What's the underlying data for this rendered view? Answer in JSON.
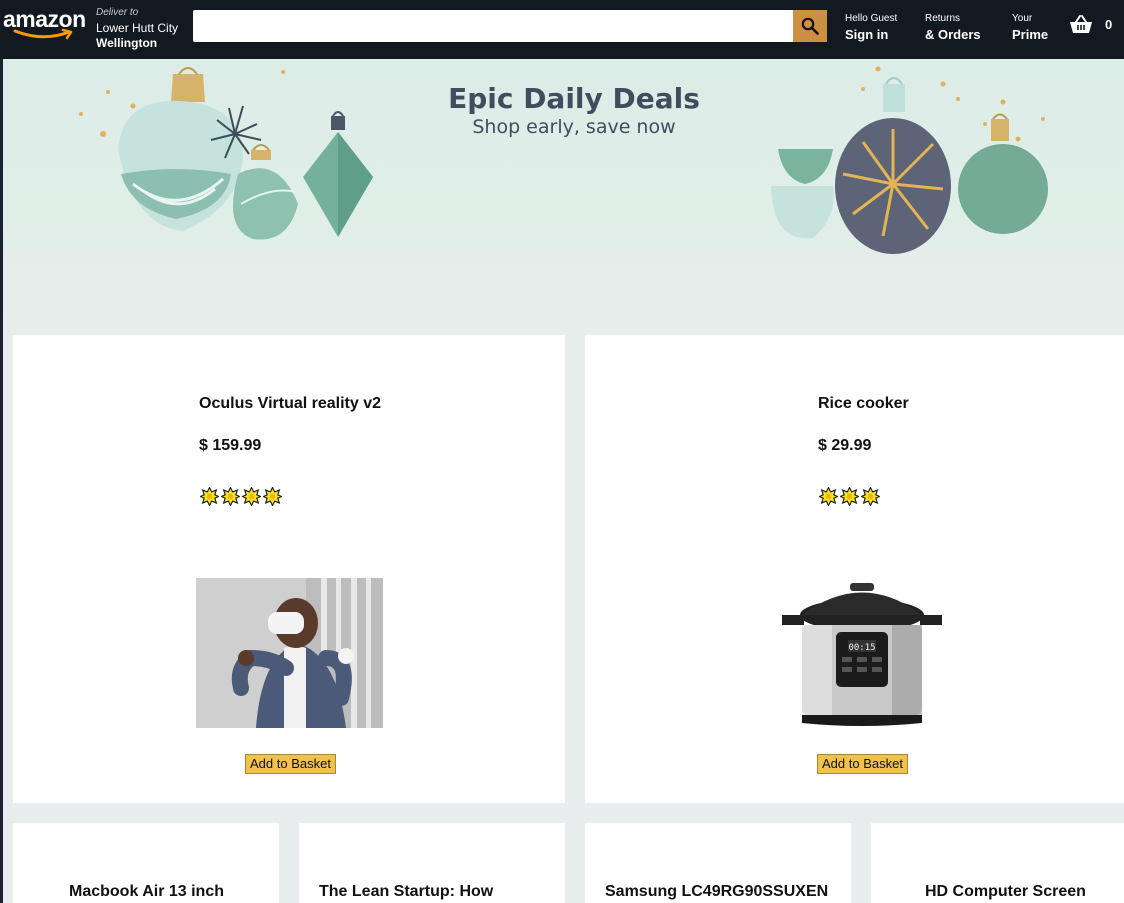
{
  "header": {
    "logo_text": "amazon",
    "deliver_to_label": "Deliver to",
    "city": "Lower Hutt City",
    "region": "Wellington",
    "search": {
      "value": "",
      "placeholder": ""
    },
    "nav": [
      {
        "small": "Hello Guest",
        "big": "Sign in"
      },
      {
        "small": "Returns",
        "big": "& Orders"
      },
      {
        "small": "Your",
        "big": "Prime"
      }
    ],
    "basket_count": "0"
  },
  "banner": {
    "title": "Epic Daily Deals",
    "subtitle": "Shop early, save now"
  },
  "products": [
    {
      "title": "Oculus Virtual reality v2",
      "price": "$ 159.99",
      "rating": 4,
      "button": "Add to Basket"
    },
    {
      "title": "Rice cooker",
      "price": "$ 29.99",
      "rating": 3,
      "button": "Add to Basket"
    },
    {
      "title": "Macbook Air 13 inch"
    },
    {
      "title": "The Lean Startup: How"
    },
    {
      "title": "Samsung LC49RG90SSUXEN"
    },
    {
      "title": "HD Computer Screen"
    }
  ],
  "colors": {
    "header_bg": "#131921",
    "search_button": "#cd9042",
    "add_button": "#f0c14b",
    "page_bg": "#eaeded"
  },
  "icons": [
    "search-icon",
    "basket-icon",
    "star-icon",
    "amazon-smile-icon"
  ]
}
